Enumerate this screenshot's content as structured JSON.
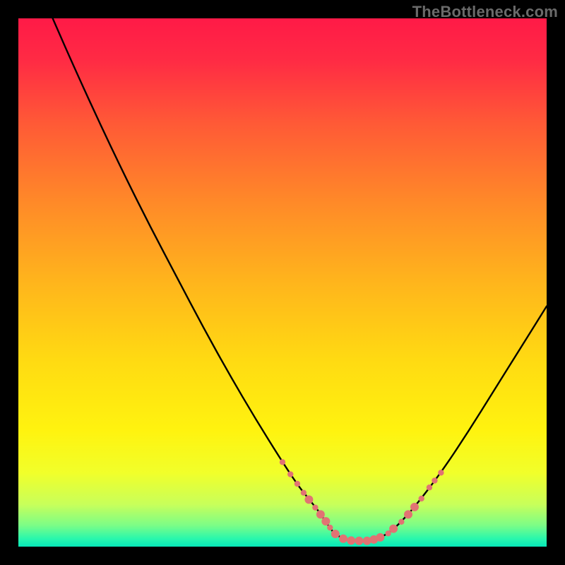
{
  "watermark": {
    "text": "TheBottleneck.com"
  },
  "colors": {
    "frame": "#000000",
    "curve": "#000000",
    "marker": "#e17373",
    "gradient_stops": [
      {
        "offset": 0.0,
        "color": "#ff1a47"
      },
      {
        "offset": 0.08,
        "color": "#ff2b44"
      },
      {
        "offset": 0.2,
        "color": "#ff5a36"
      },
      {
        "offset": 0.35,
        "color": "#ff8a28"
      },
      {
        "offset": 0.5,
        "color": "#ffb51c"
      },
      {
        "offset": 0.65,
        "color": "#ffdb12"
      },
      {
        "offset": 0.78,
        "color": "#fff30f"
      },
      {
        "offset": 0.86,
        "color": "#f1ff2a"
      },
      {
        "offset": 0.92,
        "color": "#c8ff5a"
      },
      {
        "offset": 0.96,
        "color": "#7bfd87"
      },
      {
        "offset": 0.985,
        "color": "#29f7ad"
      },
      {
        "offset": 1.0,
        "color": "#06e6b8"
      }
    ]
  },
  "chart_data": {
    "type": "line",
    "title": "",
    "xlabel": "",
    "ylabel": "",
    "xlim": [
      0,
      100
    ],
    "ylim": [
      0,
      100
    ],
    "grid": false,
    "legend": false,
    "series": [
      {
        "name": "bottleneck-curve",
        "x": [
          6.5,
          10,
          15,
          20,
          25,
          30,
          35,
          40,
          45,
          50,
          53,
          55,
          57,
          58,
          59,
          60,
          62,
          64,
          66,
          68,
          70,
          72,
          75,
          80,
          85,
          90,
          95,
          100
        ],
        "y": [
          100,
          92,
          81,
          70.5,
          60.5,
          51,
          41.5,
          32.5,
          24,
          16,
          11.5,
          9,
          6.5,
          5,
          3.5,
          2.3,
          1.3,
          1.1,
          1.1,
          1.5,
          2.5,
          4.2,
          7.5,
          14,
          21.5,
          29.5,
          37.5,
          45.5
        ]
      }
    ],
    "markers": {
      "name": "highlight-dots",
      "color": "#e17373",
      "radius_small": 4.2,
      "radius_large": 6.0,
      "points": [
        {
          "x": 50.0,
          "y": 16.0,
          "r": "small"
        },
        {
          "x": 51.5,
          "y": 13.7,
          "r": "small"
        },
        {
          "x": 52.8,
          "y": 11.9,
          "r": "small"
        },
        {
          "x": 54.0,
          "y": 10.2,
          "r": "small"
        },
        {
          "x": 55.0,
          "y": 8.9,
          "r": "large"
        },
        {
          "x": 56.2,
          "y": 7.4,
          "r": "small"
        },
        {
          "x": 57.2,
          "y": 6.1,
          "r": "large"
        },
        {
          "x": 58.2,
          "y": 4.8,
          "r": "large"
        },
        {
          "x": 59.0,
          "y": 3.6,
          "r": "small"
        },
        {
          "x": 60.0,
          "y": 2.4,
          "r": "large"
        },
        {
          "x": 61.5,
          "y": 1.5,
          "r": "large"
        },
        {
          "x": 63.0,
          "y": 1.15,
          "r": "large"
        },
        {
          "x": 64.5,
          "y": 1.1,
          "r": "large"
        },
        {
          "x": 66.0,
          "y": 1.1,
          "r": "large"
        },
        {
          "x": 67.3,
          "y": 1.35,
          "r": "large"
        },
        {
          "x": 68.5,
          "y": 1.75,
          "r": "large"
        },
        {
          "x": 70.0,
          "y": 2.5,
          "r": "small"
        },
        {
          "x": 71.0,
          "y": 3.4,
          "r": "large"
        },
        {
          "x": 72.5,
          "y": 4.7,
          "r": "small"
        },
        {
          "x": 73.8,
          "y": 6.1,
          "r": "large"
        },
        {
          "x": 75.0,
          "y": 7.5,
          "r": "large"
        },
        {
          "x": 76.3,
          "y": 9.1,
          "r": "small"
        },
        {
          "x": 77.8,
          "y": 11.2,
          "r": "small"
        },
        {
          "x": 78.8,
          "y": 12.5,
          "r": "small"
        },
        {
          "x": 80.0,
          "y": 14.0,
          "r": "small"
        }
      ]
    }
  }
}
